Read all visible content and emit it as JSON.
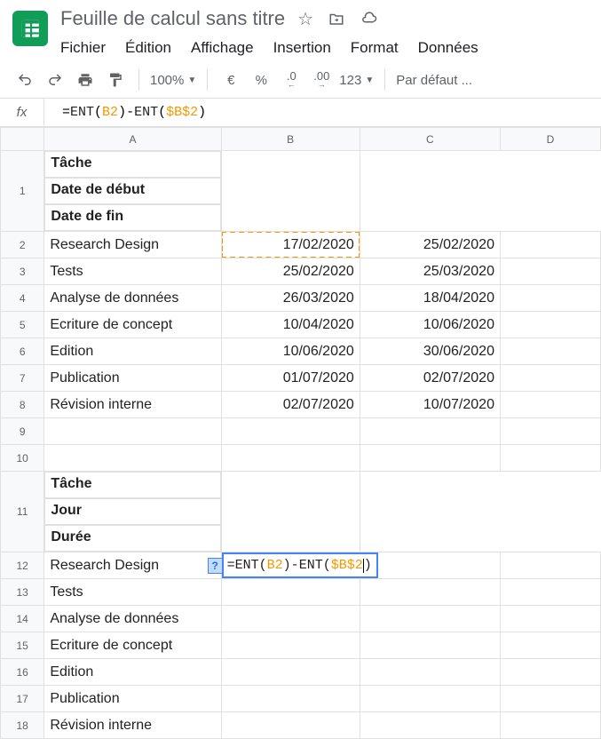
{
  "doc_title": "Feuille de calcul sans titre",
  "menus": [
    "Fichier",
    "Édition",
    "Affichage",
    "Insertion",
    "Format",
    "Données"
  ],
  "toolbar": {
    "zoom": "100%",
    "currency": "€",
    "percent": "%",
    "dec_minus": ".0",
    "dec_plus": ".00",
    "num_format": "123",
    "font": "Par défaut ..."
  },
  "formula": {
    "prefix": "=",
    "fn1": "ENT",
    "lp": "(",
    "ref1": "B2",
    "rp": ")",
    "minus": "-",
    "fn2": "ENT",
    "ref2": "$B$2"
  },
  "columns": [
    "A",
    "B",
    "C",
    "D"
  ],
  "rows": [
    {
      "n": "1",
      "a": "Tâche",
      "b": "Date de début",
      "c": "Date de fin",
      "header": true
    },
    {
      "n": "2",
      "a": "Research Design",
      "b": "17/02/2020",
      "c": "25/02/2020"
    },
    {
      "n": "3",
      "a": "Tests",
      "b": "25/02/2020",
      "c": "25/03/2020"
    },
    {
      "n": "4",
      "a": "Analyse de données",
      "b": "26/03/2020",
      "c": "18/04/2020"
    },
    {
      "n": "5",
      "a": "Ecriture de concept",
      "b": "10/04/2020",
      "c": "10/06/2020"
    },
    {
      "n": "6",
      "a": "Edition",
      "b": "10/06/2020",
      "c": "30/06/2020"
    },
    {
      "n": "7",
      "a": "Publication",
      "b": "01/07/2020",
      "c": "02/07/2020"
    },
    {
      "n": "8",
      "a": "Révision interne",
      "b": "02/07/2020",
      "c": "10/07/2020"
    },
    {
      "n": "9",
      "a": "",
      "b": "",
      "c": ""
    },
    {
      "n": "10",
      "a": "",
      "b": "",
      "c": ""
    },
    {
      "n": "11",
      "a": "Tâche",
      "b": "Jour",
      "c": "Durée",
      "header": true
    },
    {
      "n": "12",
      "a": "Research Design",
      "editing": true
    },
    {
      "n": "13",
      "a": "Tests"
    },
    {
      "n": "14",
      "a": "Analyse de données"
    },
    {
      "n": "15",
      "a": "Ecriture de concept"
    },
    {
      "n": "16",
      "a": "Edition"
    },
    {
      "n": "17",
      "a": "Publication"
    },
    {
      "n": "18",
      "a": "Révision interne"
    }
  ],
  "help_badge": "?"
}
